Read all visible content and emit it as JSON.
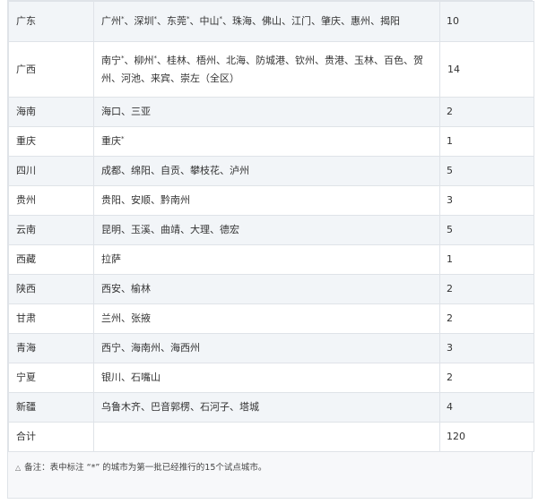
{
  "rows": [
    {
      "province": "广东",
      "cities": [
        {
          "t": "广州",
          "star": true
        },
        {
          "t": "、深圳",
          "star": true
        },
        {
          "t": "、东莞",
          "star": true
        },
        {
          "t": "、中山",
          "star": true
        },
        {
          "t": "、珠海、佛山、江门、肇庆、惠州、揭阳",
          "star": false
        }
      ],
      "count": "10"
    },
    {
      "province": "广西",
      "cities_line1": [
        {
          "t": "南宁",
          "star": true
        },
        {
          "t": "、柳州",
          "star": true
        },
        {
          "t": "、桂林、梧州、北海、防城港、钦州、贵港、玉林、百色、贺",
          "star": false
        }
      ],
      "cities_line2": "州、河池、来宾、崇左（全区）",
      "count": "14"
    },
    {
      "province": "海南",
      "cities": [
        {
          "t": "海口、三亚",
          "star": false
        }
      ],
      "count": "2"
    },
    {
      "province": "重庆",
      "cities": [
        {
          "t": "重庆",
          "star": true
        }
      ],
      "count": "1"
    },
    {
      "province": "四川",
      "cities": [
        {
          "t": "成都、绵阳、自贡、攀枝花、泸州",
          "star": false
        }
      ],
      "count": "5"
    },
    {
      "province": "贵州",
      "cities": [
        {
          "t": "贵阳、安顺、黔南州",
          "star": false
        }
      ],
      "count": "3"
    },
    {
      "province": "云南",
      "cities": [
        {
          "t": "昆明、玉溪、曲靖、大理、德宏",
          "star": false
        }
      ],
      "count": "5"
    },
    {
      "province": "西藏",
      "cities": [
        {
          "t": "拉萨",
          "star": false
        }
      ],
      "count": "1"
    },
    {
      "province": "陕西",
      "cities": [
        {
          "t": "西安、榆林",
          "star": false
        }
      ],
      "count": "2"
    },
    {
      "province": "甘肃",
      "cities": [
        {
          "t": "兰州、张掖",
          "star": false
        }
      ],
      "count": "2"
    },
    {
      "province": "青海",
      "cities": [
        {
          "t": "西宁、海南州、海西州",
          "star": false
        }
      ],
      "count": "3"
    },
    {
      "province": "宁夏",
      "cities": [
        {
          "t": "银川、石嘴山",
          "star": false
        }
      ],
      "count": "2"
    },
    {
      "province": "新疆",
      "cities": [
        {
          "t": "乌鲁木齐、巴音郭楞、石河子、塔城",
          "star": false
        }
      ],
      "count": "4"
    }
  ],
  "total": {
    "label": "合计",
    "count": "120"
  },
  "note": {
    "mark": "△",
    "text": "备注：表中标注 “*” 的城市为第一批已经推行的15个试点城市。"
  },
  "star_symbol": "*"
}
